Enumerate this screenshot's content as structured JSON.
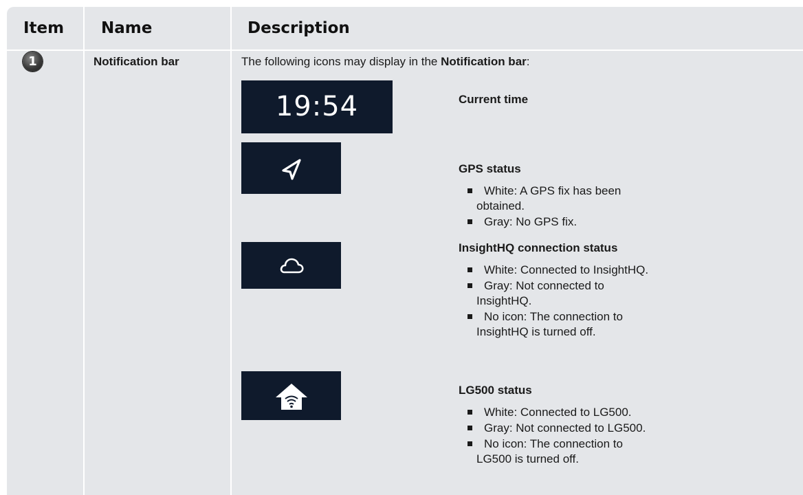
{
  "header": {
    "item": "Item",
    "name": "Name",
    "description": "Description"
  },
  "row": {
    "item_number": "1",
    "name": "Notification bar",
    "intro_prefix": "The following icons may display in the ",
    "intro_bold": "Notification bar",
    "intro_suffix": ":",
    "icons": {
      "time": {
        "icon": "clock-display",
        "text": "19:54"
      },
      "gps": {
        "icon": "navigation-arrow-icon"
      },
      "cloud": {
        "icon": "cloud-icon"
      },
      "lg500": {
        "icon": "house-wifi-icon"
      }
    },
    "entries": [
      {
        "title": "Current time",
        "bullets": []
      },
      {
        "title": "GPS status",
        "bullets": [
          {
            "line1": "White: A GPS fix has been",
            "line2": "obtained."
          },
          {
            "line1": "Gray: No GPS fix.",
            "line2": ""
          }
        ]
      },
      {
        "title": "InsightHQ connection status",
        "bullets": [
          {
            "line1": "White: Connected to InsightHQ.",
            "line2": ""
          },
          {
            "line1": "Gray: Not connected to",
            "line2": "InsightHQ."
          },
          {
            "line1": "No icon: The connection to",
            "line2": "InsightHQ is turned off."
          }
        ]
      },
      {
        "title": "LG500 status",
        "bullets": [
          {
            "line1": "White: Connected to LG500.",
            "line2": ""
          },
          {
            "line1": "Gray: Not connected to LG500.",
            "line2": ""
          },
          {
            "line1": "No icon: The connection to",
            "line2": "LG500 is turned off."
          }
        ]
      }
    ]
  },
  "colors": {
    "table_bg": "#e4e6e9",
    "icon_bg": "#0f1a2c",
    "icon_fg": "#ffffff"
  }
}
